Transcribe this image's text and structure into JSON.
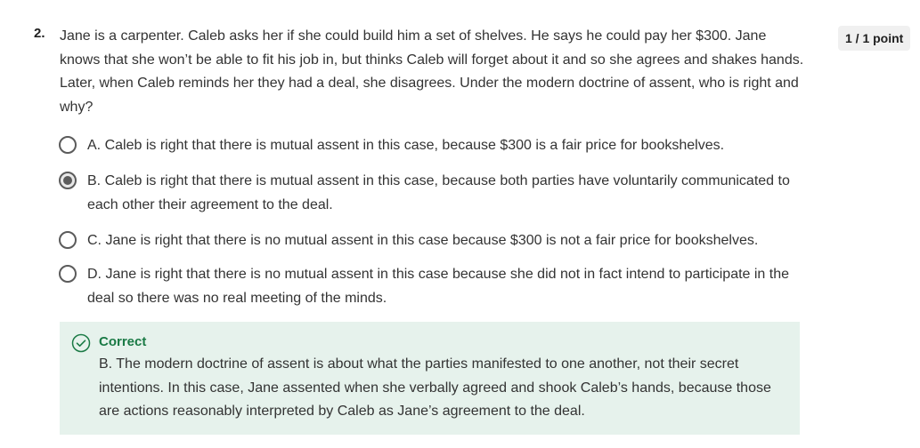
{
  "question": {
    "number": "2.",
    "text": "Jane is a carpenter. Caleb asks her if she could build him a set of shelves. He says he could pay her $300. Jane knows that she won’t be able to fit his job in, but thinks Caleb will forget about it and so she agrees and shakes hands. Later, when Caleb reminds her they had a deal, she disagrees. Under the modern doctrine of assent, who is right and why?",
    "points": "1 / 1 point"
  },
  "options": [
    {
      "label": "A. Caleb is right that there is mutual assent in this case, because $300 is a fair price for bookshelves.",
      "selected": false
    },
    {
      "label": "B. Caleb is right that there is mutual assent in this case, because both parties have voluntarily communicated to each other their agreement to the deal.",
      "selected": true
    },
    {
      "label": "C. Jane is right that there is no mutual assent in this case because $300 is not a fair price for bookshelves.",
      "selected": false
    },
    {
      "label": "D. Jane is right that there is no mutual assent in this case because she did not in fact intend to participate in the deal so there was no real meeting of the minds.",
      "selected": false
    }
  ],
  "feedback": {
    "status": "Correct",
    "icon": "check-circle-icon",
    "text": "B.   The modern doctrine of assent is about what the parties manifested to one another, not their secret intentions. In this case, Jane assented when she verbally agreed and shook Caleb’s hands, because those are actions reasonably interpreted by Caleb as Jane’s agreement to the deal."
  },
  "colors": {
    "correct_green": "#1a7a45",
    "feedback_bg": "#e6f2ec",
    "radio_border": "#5b5b5b",
    "badge_bg": "#f0f0f0"
  }
}
